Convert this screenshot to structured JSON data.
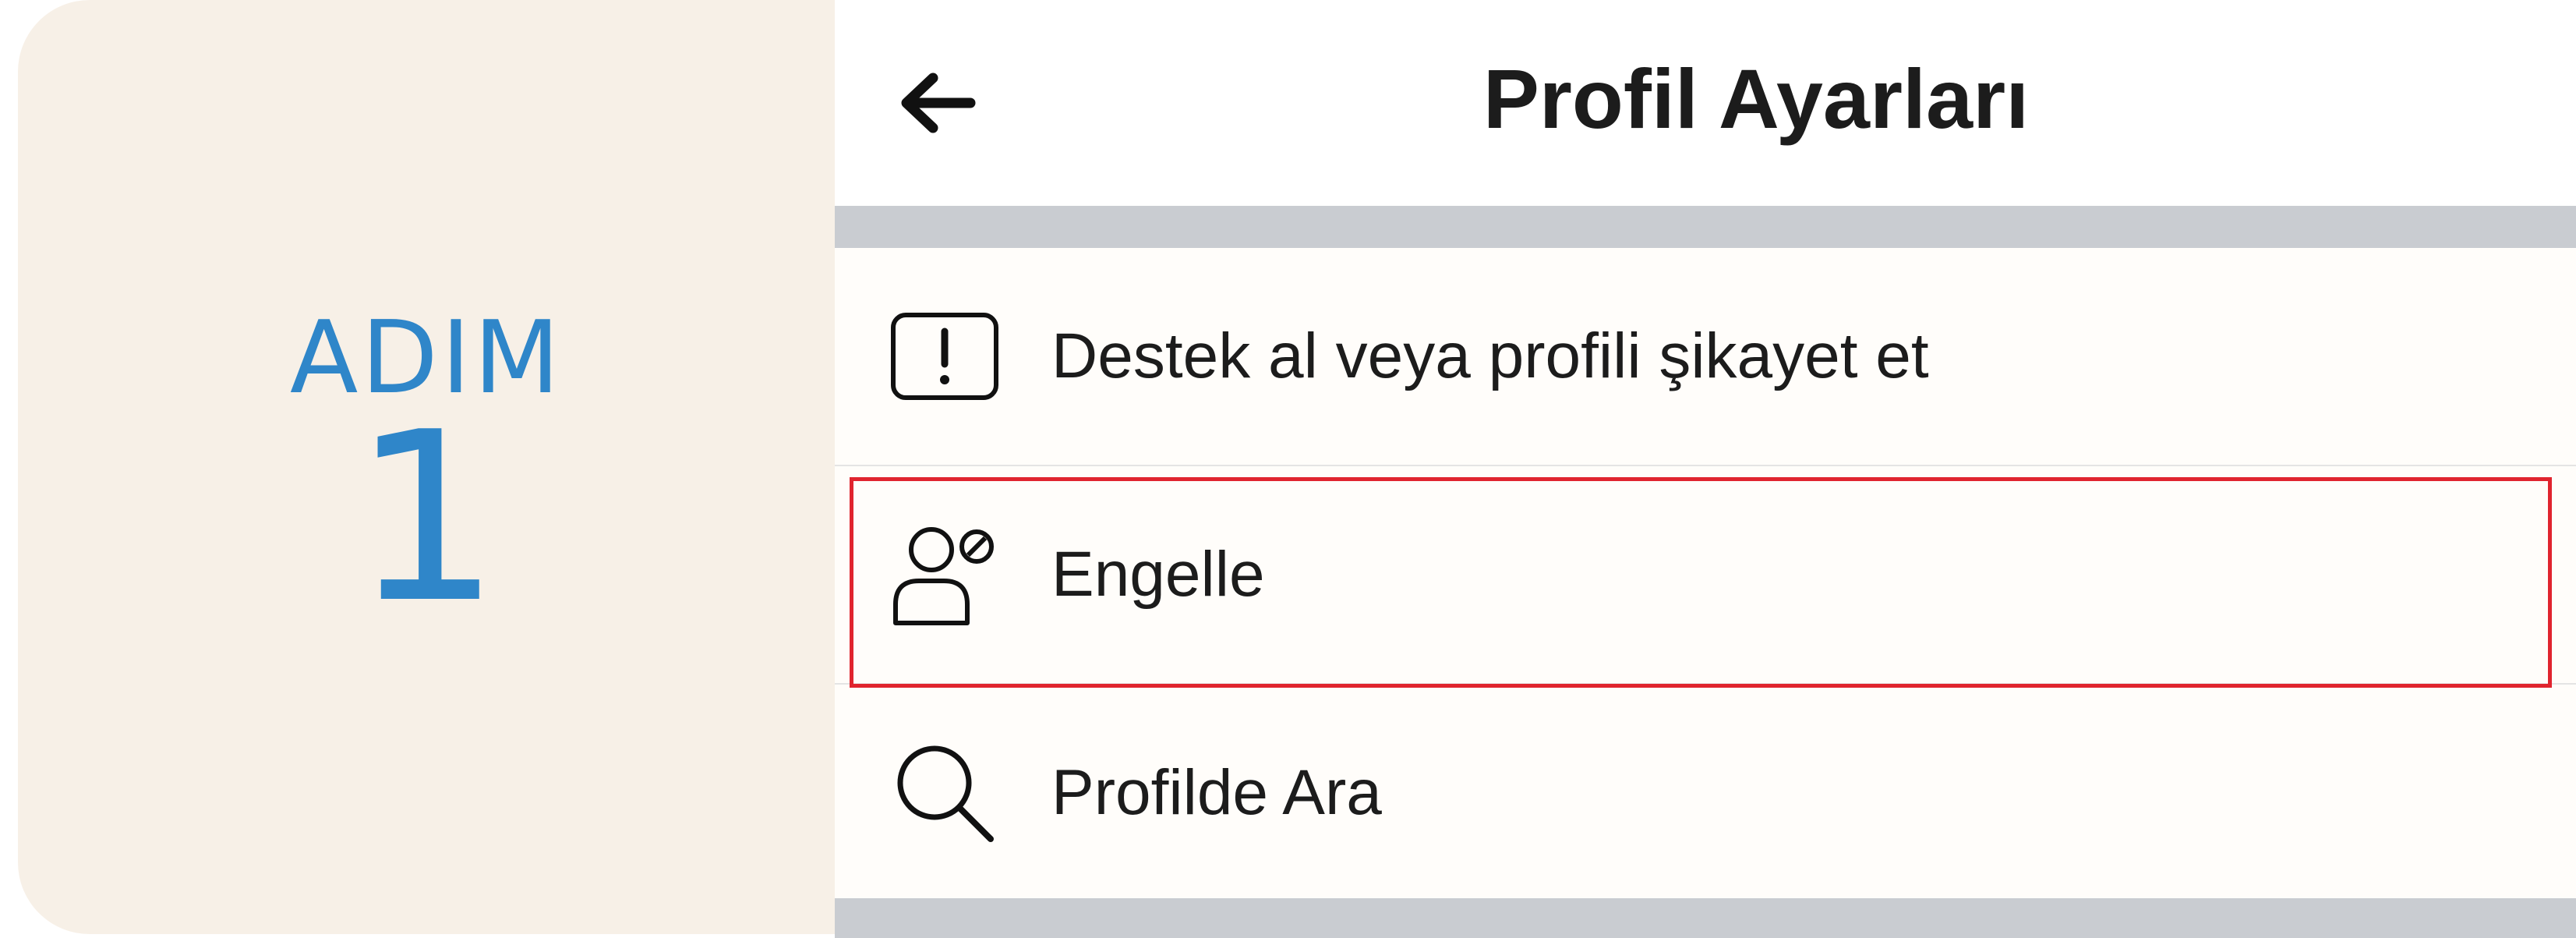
{
  "step": {
    "label": "ADIM",
    "number": "1",
    "label_color": "#2f86c9",
    "panel_color": "#f7f0e7"
  },
  "header": {
    "title": "Profil Ayarları",
    "back_icon": "arrow-left-icon"
  },
  "menu": {
    "items": [
      {
        "label": "Destek al veya profili şikayet et",
        "icon": "report-exclamation-icon",
        "highlighted": false
      },
      {
        "label": "Engelle",
        "icon": "block-user-icon",
        "highlighted": true
      },
      {
        "label": "Profilde Ara",
        "icon": "search-icon",
        "highlighted": false
      }
    ]
  },
  "colors": {
    "highlight": "#e0242e",
    "divider": "#c9ccd1"
  }
}
